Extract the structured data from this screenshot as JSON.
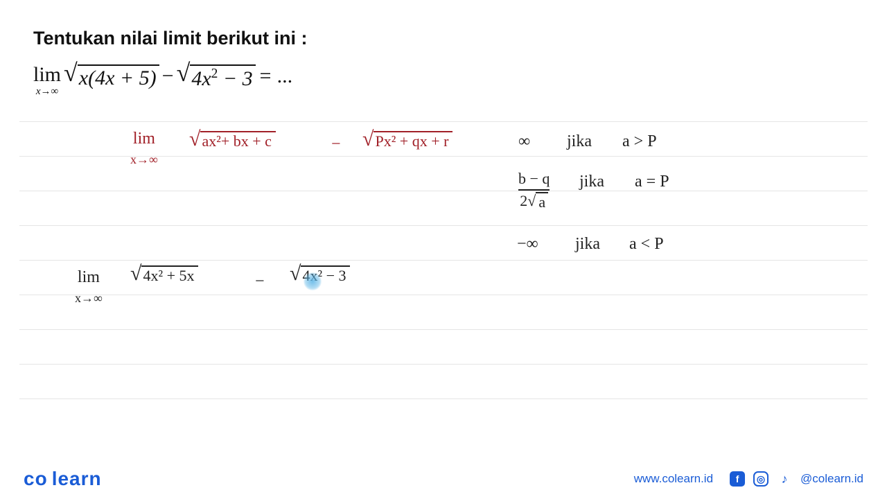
{
  "title": "Tentukan nilai limit berikut ini :",
  "problem": {
    "lim": "lim",
    "cond": "x→∞",
    "sqrt1_inner": "x(4x + 5)",
    "minus": " − ",
    "sqrt2_inner_a": "4x",
    "sqrt2_inner_b": " − 3",
    "tail": " = ..."
  },
  "formula": {
    "lim": "lim",
    "cond": "x→∞",
    "sqrt1": "ax²+ bx + c",
    "minus": "−",
    "sqrt2": "Px² + qx + r"
  },
  "cases": {
    "c1_left": "∞",
    "c1_word": "jika",
    "c1_cond": "a > P",
    "c2_num": "b − q",
    "c2_den_coef": "2",
    "c2_den_rad": "a",
    "c2_word": "jika",
    "c2_cond": "a = P",
    "c3_left": "−∞",
    "c3_word": "jika",
    "c3_cond": "a < P"
  },
  "work": {
    "lim": "lim",
    "cond": "x→∞",
    "sqrt1": "4x² + 5x",
    "minus": "−",
    "sqrt2": "4x² − 3"
  },
  "footer": {
    "logo_a": "co",
    "logo_b": "learn",
    "url": "www.colearn.id",
    "handle": "@colearn.id",
    "icons": {
      "fb": "f",
      "ig": "◎",
      "tk": "♪"
    }
  }
}
